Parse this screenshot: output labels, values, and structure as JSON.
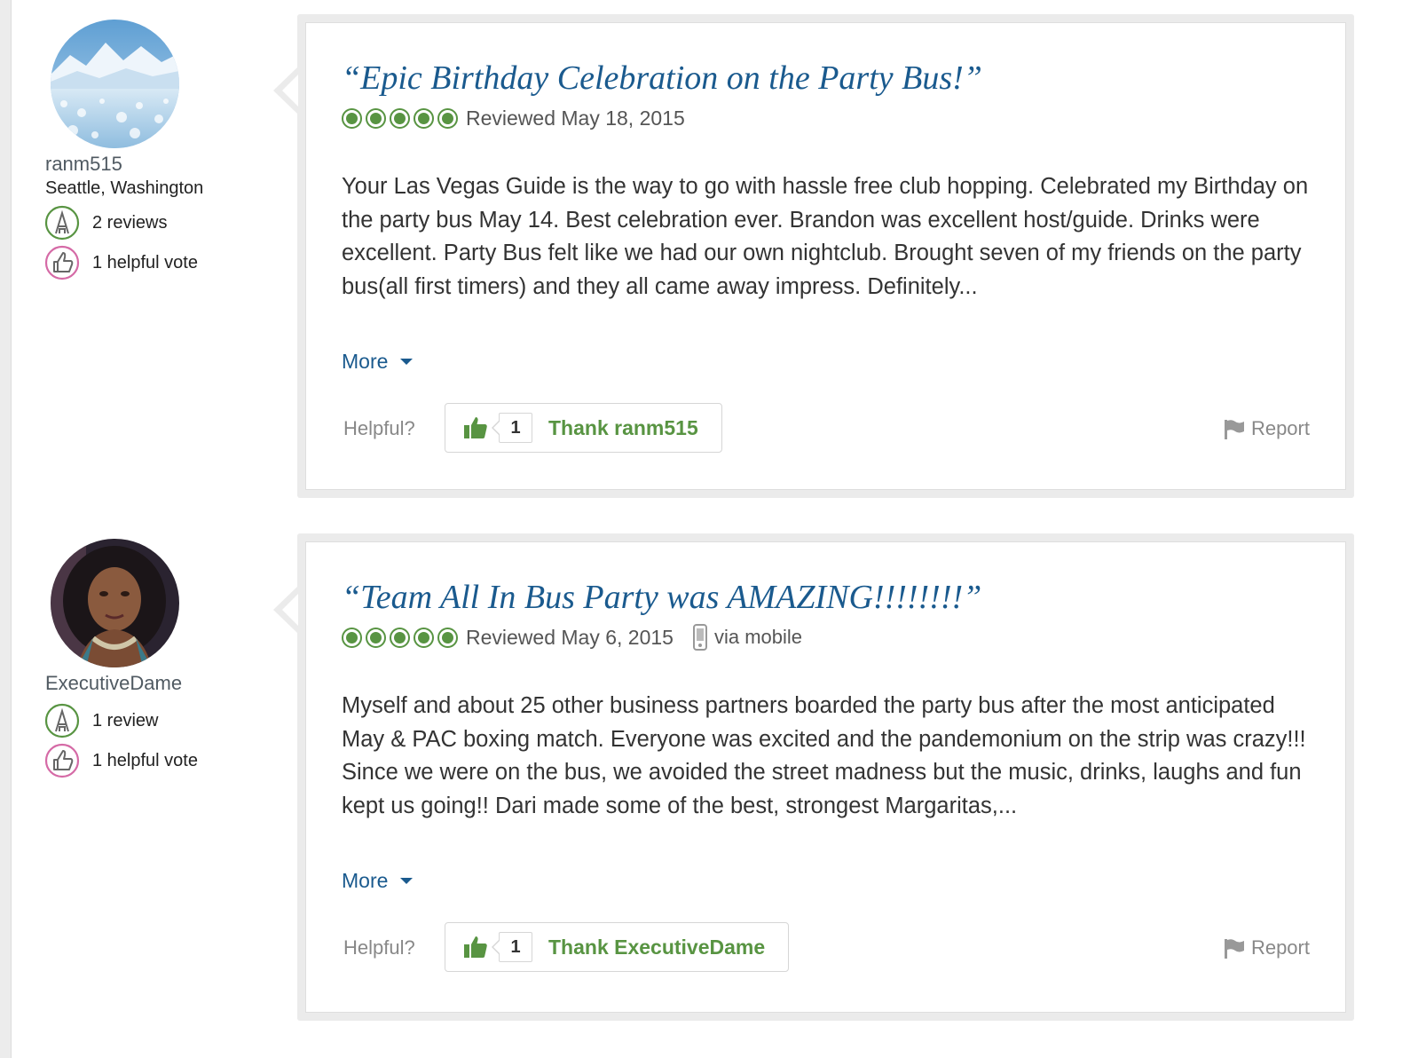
{
  "colors": {
    "title_blue": "#1a5a8e",
    "bubble_green": "#589442",
    "thank_green": "#589442",
    "muted_gray": "#888888",
    "card_border": "#ebebeb"
  },
  "reviews": [
    {
      "user": {
        "name": "ranm515",
        "location": "Seattle, Washington",
        "reviews_count": "2 reviews",
        "helpful_votes": "1 helpful vote",
        "avatar": "glacier-landscape-photo"
      },
      "title": "“Epic Birthday Celebration on the Party Bus!”",
      "rating": 5,
      "reviewed_date": "Reviewed May 18, 2015",
      "via_mobile": "",
      "body": "Your Las Vegas Guide is the way to go with hassle free club hopping. Celebrated my Birthday on the party bus May 14. Best celebration ever. Brandon was excellent host/guide. Drinks were excellent. Party Bus felt like we had our own nightclub. Brought seven of my friends on the party bus(all first timers) and they all came away impress. Definitely...",
      "more_label": "More",
      "helpful_label": "Helpful?",
      "thank_count": "1",
      "thank_label": "Thank ranm515",
      "report_label": "Report"
    },
    {
      "user": {
        "name": "ExecutiveDame",
        "location": "",
        "reviews_count": "1 review",
        "helpful_votes": "1 helpful vote",
        "avatar": "woman-portrait-photo"
      },
      "title": "“Team All In Bus Party was AMAZING!!!!!!!!”",
      "rating": 5,
      "reviewed_date": "Reviewed May 6, 2015",
      "via_mobile": "via mobile",
      "body": "Myself and about 25 other business partners boarded the party bus after the most anticipated May & PAC boxing match. Everyone was excited and the pandemonium on the strip was crazy!!! Since we were on the bus, we avoided the street madness but the music, drinks, laughs and fun kept us going!! Dari made some of the best, strongest Margaritas,...",
      "more_label": "More",
      "helpful_label": "Helpful?",
      "thank_count": "1",
      "thank_label": "Thank ExecutiveDame",
      "report_label": "Report"
    }
  ]
}
